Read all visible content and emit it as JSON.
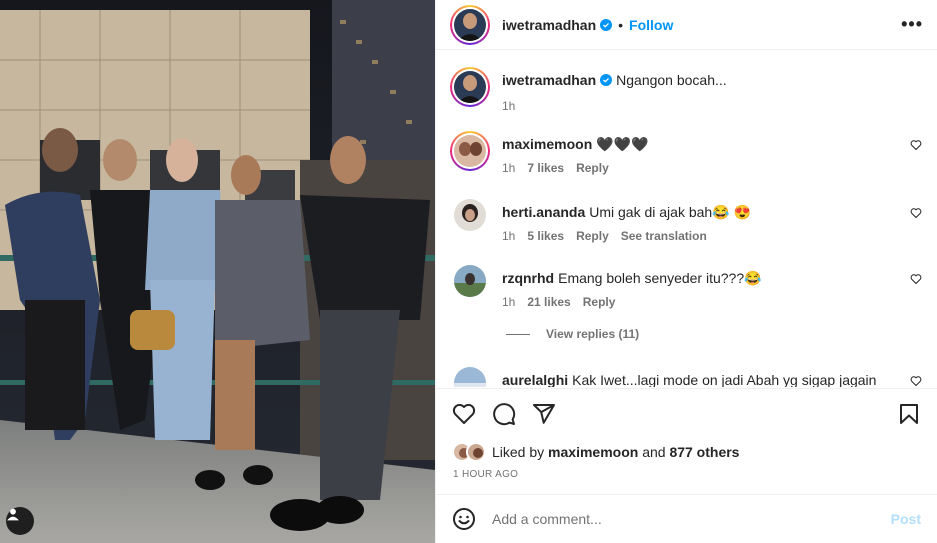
{
  "post": {
    "author": "iwetramadhan",
    "follow_label": "Follow",
    "dot": "•",
    "more_label": "•••",
    "caption": "Ngangon bocah...",
    "caption_time": "1h"
  },
  "comments": [
    {
      "user": "maximemoon",
      "text": "🖤🖤🖤",
      "time": "1h",
      "likes": "7 likes",
      "reply": "Reply"
    },
    {
      "user": "herti.ananda",
      "text": "Umi gak di ajak bah😂 😍",
      "time": "1h",
      "likes": "5 likes",
      "reply": "Reply",
      "translate": "See translation"
    },
    {
      "user": "rzqnrhd",
      "text": "Emang boleh senyeder itu???😂",
      "time": "1h",
      "likes": "21 likes",
      "reply": "Reply"
    },
    {
      "user": "aurelalghi",
      "text": "Kak Iwet...lagi mode on jadi Abah yg sigap jagain"
    }
  ],
  "view_replies": "View replies (11)",
  "likes": {
    "prefix": "Liked by",
    "user": "maximemoon",
    "and": "and",
    "others": "877 others"
  },
  "time_ago": "1 HOUR AGO",
  "add_comment": {
    "placeholder": "Add a comment...",
    "post_label": "Post"
  },
  "icons": [
    "heart-icon",
    "comment-icon",
    "share-icon",
    "bookmark-icon",
    "emoji-icon",
    "user-tag-icon",
    "verified-icon",
    "more-icon"
  ],
  "colors": {
    "accent": "#0095f6",
    "post_disabled": "#b2dffc",
    "meta": "#737373"
  }
}
